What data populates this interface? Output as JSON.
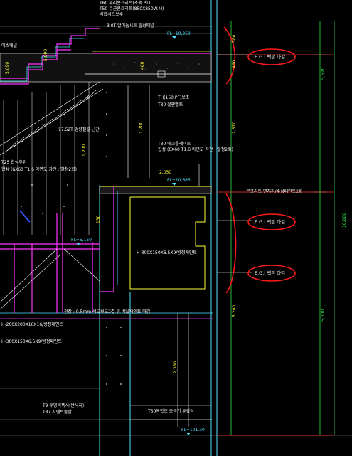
{
  "drawing": {
    "top_notes": [
      "T60 푸리콘크리트(초속 PT)",
      "3.0T 알미늄시트 합성패널",
      "T50 무근콘크리트(850X850W.M)",
      "배합시트보수"
    ],
    "top_lines_left": [
      "이소패널",
      "3.0T 알미늄시트 플소(단일결지)"
    ],
    "levels": {
      "l1": "FL+10,950",
      "l2": "FL+10,665",
      "l3": "FL+5,150",
      "l4": "FL+101.30"
    },
    "notes": {
      "beam_stud": "TH(150 PF)보조",
      "beam_stud2": "T30 철판벨트",
      "light_frame": "17.52T 경량철골 난간",
      "deck1": "T30 데크플레이트",
      "deck2": "합성 (6X60 T1.6 아연도 각관 : 발청2회)",
      "left_frame1": "T25 합성추위",
      "left_frame2": "합성 (6X60 T1.6 아연도 각관 : 발청2회)",
      "concrete_slab": "콘크리트 면처리/수성페인트2회",
      "beam_h": "H-300X150X6.5X9/방청페인트",
      "ceiling": "천장 : 9.5mm 석고보드2겹 위 비닐페인트 마감",
      "h_left1": "H-200X200X10X16/방청페인트",
      "h_left2": "H-300X150X6.5X9/방청페인트",
      "bottom1": "T9 투명색폭시(반사지)",
      "bottom2": "T87 시멘트몰탈",
      "bottom_right": "T30복합조 종금기 두강석"
    },
    "callouts": [
      "E.G.I 백판 마감",
      "E.G.I 백판 마감",
      "E.G.I 백판 마감"
    ],
    "dims_right": [
      "580",
      "460",
      "2,370",
      "5,620",
      "10,000",
      "5,200",
      "5,000"
    ],
    "dims_mid": [
      "2,050",
      "1,200",
      "1,200",
      "2,380",
      "480",
      "130"
    ],
    "dims_left": [
      "5,090",
      "5,090"
    ]
  },
  "colors": {
    "background": "#000000",
    "cyan": "#4fe3ff",
    "magenta": "#e020e0",
    "yellow": "#ffff33",
    "green": "#33ff55",
    "red": "#ff1a1a",
    "white": "#ffffff",
    "blue": "#3355ff",
    "gray": "#8c8c8c"
  }
}
